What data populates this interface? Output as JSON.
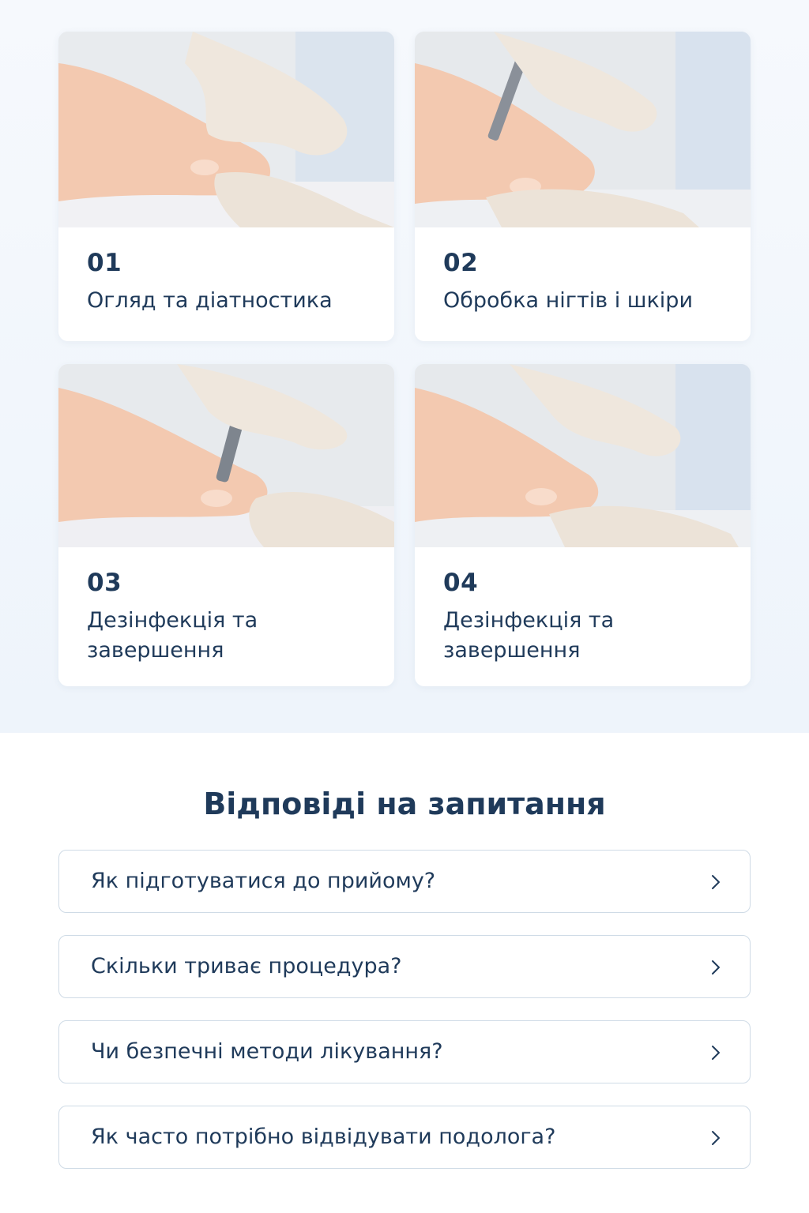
{
  "steps": [
    {
      "number": "01",
      "title": "Огляд та діатностика",
      "photo_icon": "gloved-hands-examining-foot"
    },
    {
      "number": "02",
      "title": "Обробка нігтів і шкіри",
      "photo_icon": "nail-drill-treatment"
    },
    {
      "number": "03",
      "title": "Дезінфекція та завершення",
      "photo_icon": "nail-drill-treatment"
    },
    {
      "number": "04",
      "title": "Дезінфекція та завершення",
      "photo_icon": "gloved-hands-examining-foot"
    }
  ],
  "faq": {
    "title": "Відповіді на запитання",
    "items": [
      {
        "question": "Як підготуватися до прийому?",
        "icon": "chevron-right-icon"
      },
      {
        "question": "Скільки триває процедура?",
        "icon": "chevron-right-icon"
      },
      {
        "question": "Чи безпечні методи лікування?",
        "icon": "chevron-right-icon"
      },
      {
        "question": "Як часто потрібно відвідувати подолога?",
        "icon": "chevron-right-icon"
      }
    ]
  },
  "colors": {
    "text": "#1f3a5a",
    "section_bg": "#f2f7fc",
    "card_bg": "#ffffff",
    "border": "#cfdbe6",
    "skin": "#f3c9b0",
    "glove": "#efe7dd"
  }
}
